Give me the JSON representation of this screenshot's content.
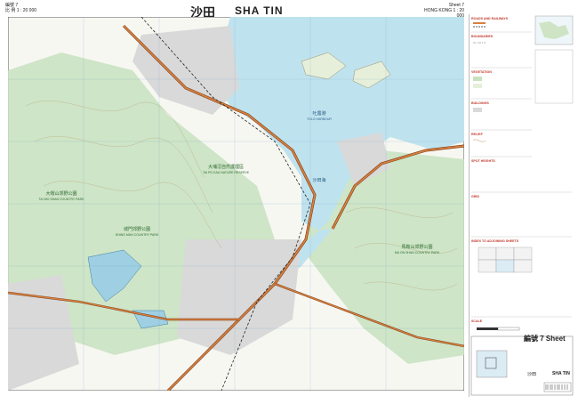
{
  "header": {
    "left_sheet_cn": "編號 7",
    "left_scale_cn": "比 例 1 : 20 000",
    "title_cn": "沙田",
    "title_en": "SHA TIN",
    "right_sheet": "Sheet 7",
    "right_scale": "HONG KONG 1 : 20 000"
  },
  "map": {
    "colors": {
      "water": "#bfe3ee",
      "land": "#ffffff",
      "vegetation": "#c7e2bf",
      "urban": "#d9d9d9",
      "road_major": "#c0612b",
      "road_outline": "#7a3d18",
      "grid": "#6a9bc2",
      "contour": "#b58d5a"
    },
    "place_labels": [
      {
        "text": "吐露港",
        "sub": "TOLO HARBOUR"
      },
      {
        "text": "馬鞍山郊野公園",
        "sub": "MA ON SHAN COUNTRY PARK"
      },
      {
        "text": "大埔滘自然護理區",
        "sub": "TAI PO KAU NATURE RESERVE"
      },
      {
        "text": "大帽山郊野公園",
        "sub": "TAI MO SHAN COUNTRY PARK"
      },
      {
        "text": "城門郊野公園",
        "sub": "SHING MUN COUNTRY PARK"
      },
      {
        "text": "沙田海",
        "sub": ""
      }
    ]
  },
  "legend": {
    "sections": [
      "ROADS AND RAILWAYS",
      "BOUNDARIES",
      "VEGETATION",
      "BUILDINGS",
      "RELIEF",
      "SPOT HEIGHTS",
      "GRID",
      "INDEX TO ADJOINING SHEETS",
      "SCALE"
    ],
    "sheet_label_cn": "編號",
    "sheet_number": "7",
    "sheet_label_en": "Sheet",
    "sheet_name_cn": "沙田",
    "sheet_name_en": "SHA TIN"
  }
}
